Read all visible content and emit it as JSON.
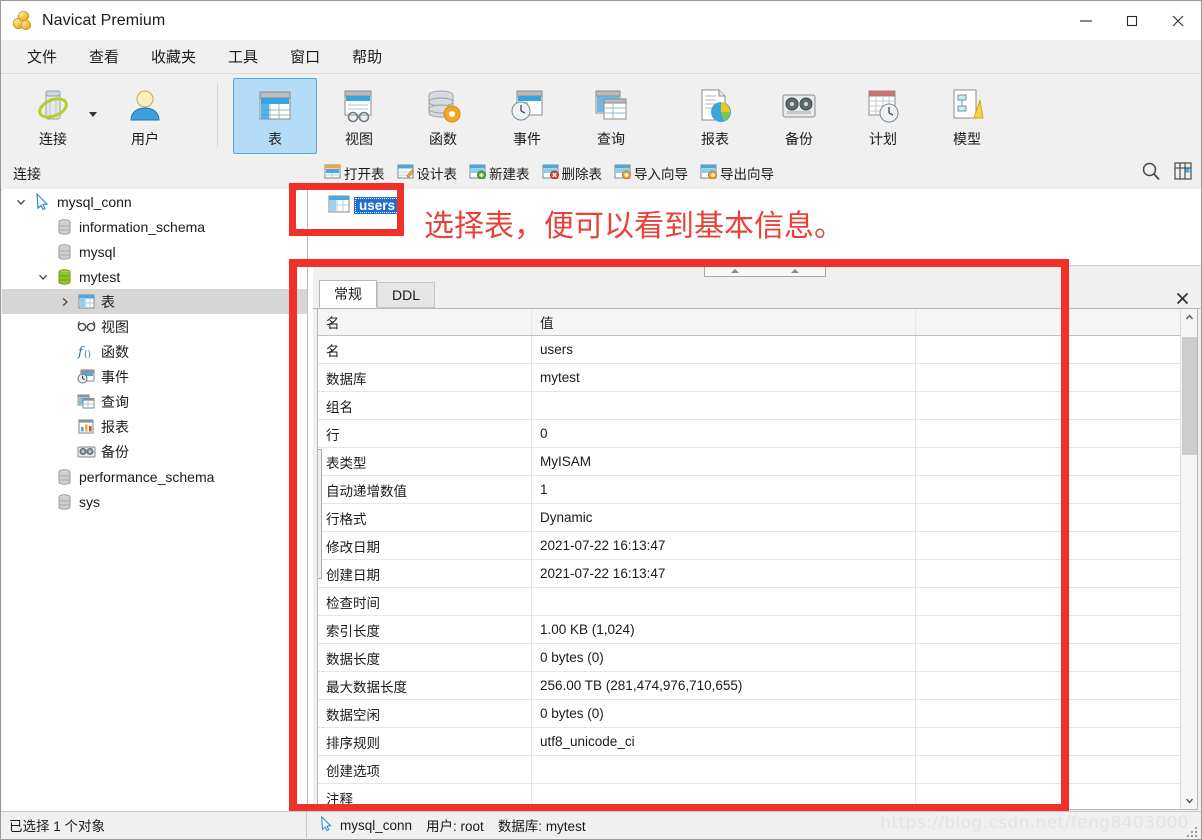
{
  "window": {
    "title": "Navicat Premium",
    "logo_icon": "navicat-logo-icon",
    "minimize_icon": "minimize-icon",
    "maximize_icon": "maximize-icon",
    "close_icon": "close-icon"
  },
  "menubar": {
    "items": [
      {
        "label": "文件",
        "name": "menu-file"
      },
      {
        "label": "查看",
        "name": "menu-view"
      },
      {
        "label": "收藏夹",
        "name": "menu-favorites"
      },
      {
        "label": "工具",
        "name": "menu-tools"
      },
      {
        "label": "窗口",
        "name": "menu-window"
      },
      {
        "label": "帮助",
        "name": "menu-help"
      }
    ]
  },
  "toolbar": {
    "buttons": [
      {
        "label": "连接",
        "icon": "connection-icon",
        "selected": false
      },
      {
        "label": "用户",
        "icon": "user-icon",
        "selected": false
      },
      {
        "label": "表",
        "icon": "table-icon",
        "selected": true
      },
      {
        "label": "视图",
        "icon": "view-icon",
        "selected": false
      },
      {
        "label": "函数",
        "icon": "function-icon",
        "selected": false
      },
      {
        "label": "事件",
        "icon": "event-icon",
        "selected": false
      },
      {
        "label": "查询",
        "icon": "query-icon",
        "selected": false
      },
      {
        "label": "报表",
        "icon": "report-icon",
        "selected": false
      },
      {
        "label": "备份",
        "icon": "backup-icon",
        "selected": false
      },
      {
        "label": "计划",
        "icon": "schedule-icon",
        "selected": false
      },
      {
        "label": "模型",
        "icon": "model-icon",
        "selected": false
      }
    ],
    "connection_dropdown_icon": "chevron-down-icon"
  },
  "subtoolbar": {
    "section_label": "连接",
    "actions": [
      {
        "label": "打开表",
        "icon": "open-table-icon"
      },
      {
        "label": "设计表",
        "icon": "design-table-icon"
      },
      {
        "label": "新建表",
        "icon": "new-table-icon"
      },
      {
        "label": "删除表",
        "icon": "delete-table-icon"
      },
      {
        "label": "导入向导",
        "icon": "import-wizard-icon"
      },
      {
        "label": "导出向导",
        "icon": "export-wizard-icon"
      }
    ],
    "search_icon": "search-icon",
    "grid_view_icon": "grid-view-icon"
  },
  "tree": {
    "nodes": [
      {
        "label": "mysql_conn",
        "icon": "connection-arrow-icon",
        "indent": 0,
        "twisty": "expanded",
        "selected": false
      },
      {
        "label": "information_schema",
        "icon": "database-gray-icon",
        "indent": 1,
        "twisty": "none",
        "selected": false
      },
      {
        "label": "mysql",
        "icon": "database-gray-icon",
        "indent": 1,
        "twisty": "none",
        "selected": false
      },
      {
        "label": "mytest",
        "icon": "database-green-icon",
        "indent": 1,
        "twisty": "expanded",
        "selected": false
      },
      {
        "label": "表",
        "icon": "table-icon",
        "indent": 2,
        "twisty": "collapsed",
        "selected": true
      },
      {
        "label": "视图",
        "icon": "view-glasses-icon",
        "indent": 2,
        "twisty": "none",
        "selected": false
      },
      {
        "label": "函数",
        "icon": "function-fx-icon",
        "indent": 2,
        "twisty": "none",
        "selected": false
      },
      {
        "label": "事件",
        "icon": "event-icon",
        "indent": 2,
        "twisty": "none",
        "selected": false
      },
      {
        "label": "查询",
        "icon": "query-icon",
        "indent": 2,
        "twisty": "none",
        "selected": false
      },
      {
        "label": "报表",
        "icon": "report-icon",
        "indent": 2,
        "twisty": "none",
        "selected": false
      },
      {
        "label": "备份",
        "icon": "backup-icon",
        "indent": 2,
        "twisty": "none",
        "selected": false
      },
      {
        "label": "performance_schema",
        "icon": "database-gray-icon",
        "indent": 1,
        "twisty": "none",
        "selected": false
      },
      {
        "label": "sys",
        "icon": "database-gray-icon",
        "indent": 1,
        "twisty": "none",
        "selected": false
      }
    ]
  },
  "object_list": {
    "items": [
      {
        "label": "users",
        "icon": "table-icon",
        "selected": true
      }
    ]
  },
  "annotation": {
    "text": "选择表，便可以看到基本信息。",
    "color": "#e8413a"
  },
  "properties_panel": {
    "tabs": [
      {
        "label": "常规",
        "active": true
      },
      {
        "label": "DDL",
        "active": false
      }
    ],
    "close_icon": "close-icon",
    "splitter_icon": "collapse-arrows-icon",
    "columns": [
      "名",
      "值",
      ""
    ],
    "rows": [
      {
        "name": "名",
        "value": "users"
      },
      {
        "name": "数据库",
        "value": "mytest"
      },
      {
        "name": "组名",
        "value": ""
      },
      {
        "name": "行",
        "value": "0"
      },
      {
        "name": "表类型",
        "value": "MyISAM"
      },
      {
        "name": "自动递增数值",
        "value": "1"
      },
      {
        "name": "行格式",
        "value": "Dynamic"
      },
      {
        "name": "修改日期",
        "value": "2021-07-22 16:13:47"
      },
      {
        "name": "创建日期",
        "value": "2021-07-22 16:13:47"
      },
      {
        "name": "检查时间",
        "value": ""
      },
      {
        "name": "索引长度",
        "value": "1.00 KB (1,024)"
      },
      {
        "name": "数据长度",
        "value": "0 bytes (0)"
      },
      {
        "name": "最大数据长度",
        "value": "256.00 TB (281,474,976,710,655)"
      },
      {
        "name": "数据空闲",
        "value": "0 bytes (0)"
      },
      {
        "name": "排序规则",
        "value": "utf8_unicode_ci"
      },
      {
        "name": "创建选项",
        "value": ""
      },
      {
        "name": "注释",
        "value": ""
      }
    ],
    "scrollbar": {
      "up_icon": "chevron-up-icon",
      "down_icon": "chevron-down-icon"
    }
  },
  "statusbar": {
    "selection_text": "已选择 1 个对象",
    "connection_icon": "connection-arrow-icon",
    "connection_name": "mysql_conn",
    "user_text": "用户: root",
    "database_text": "数据库: mytest",
    "resize_grip_icon": "resize-grip-icon"
  },
  "watermark": {
    "text": "https://blog.csdn.net/feng8403000"
  }
}
